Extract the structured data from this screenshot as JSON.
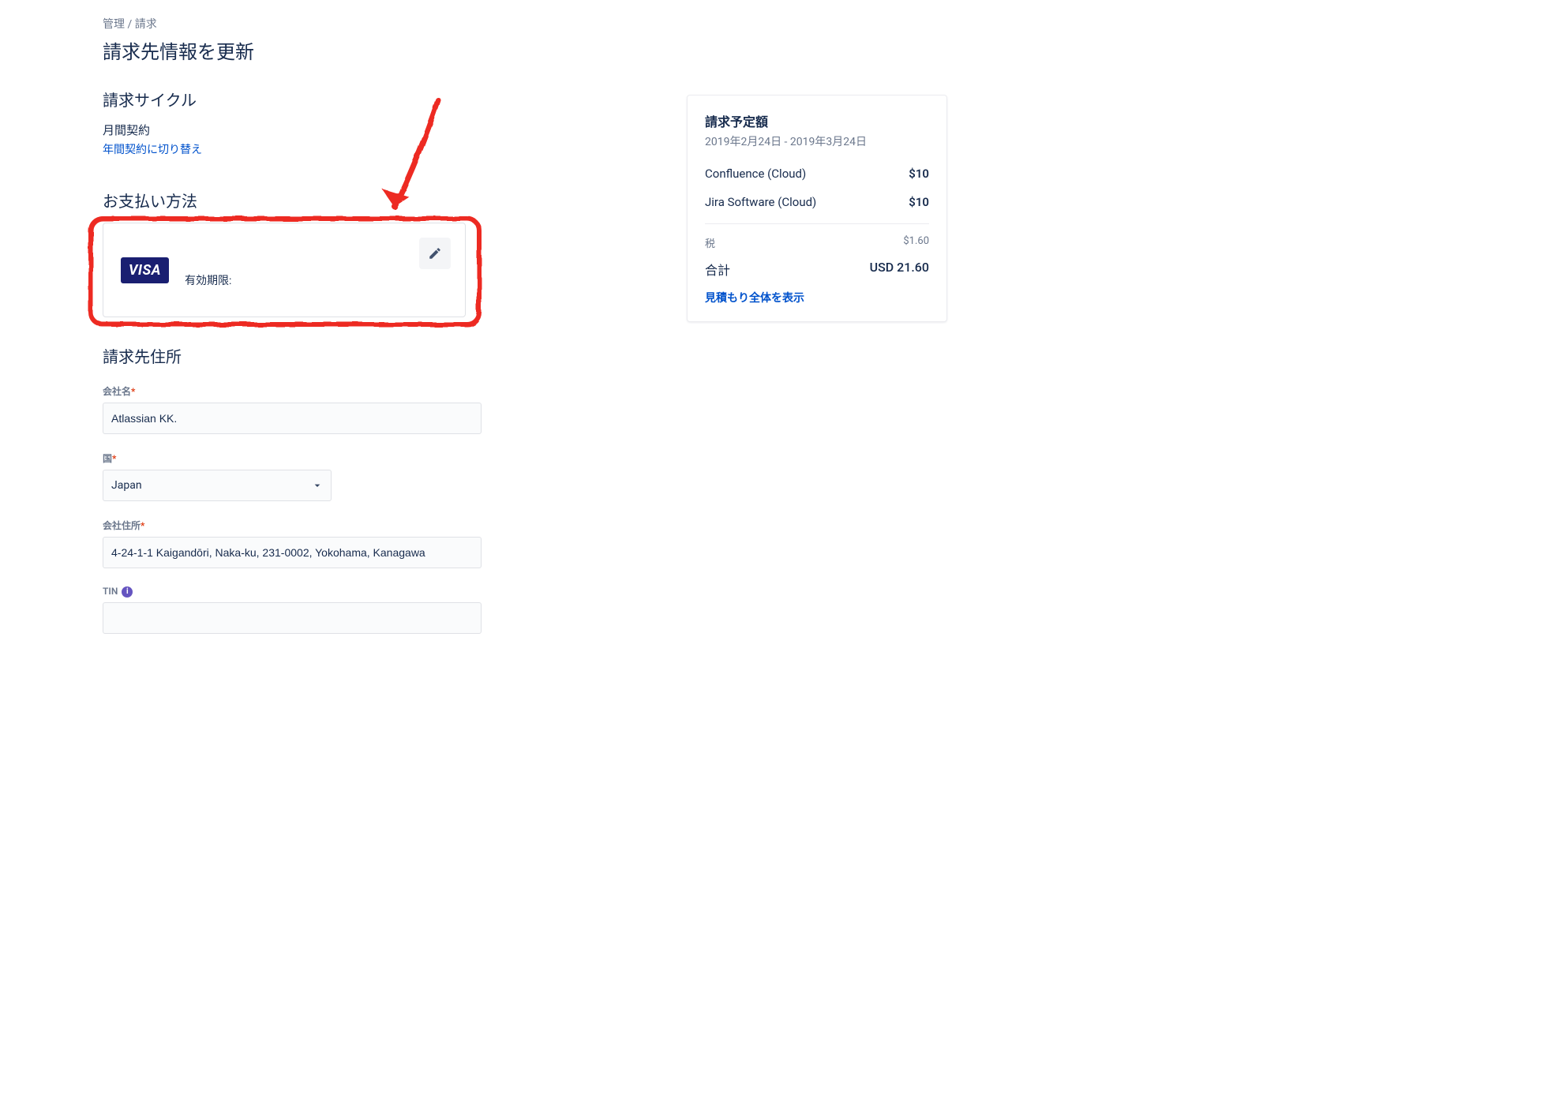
{
  "breadcrumb": {
    "admin": "管理",
    "sep": " / ",
    "billing": "請求"
  },
  "page_title": "請求先情報を更新",
  "cycle": {
    "heading": "請求サイクル",
    "current": "月間契約",
    "switch_link": "年間契約に切り替え"
  },
  "payment": {
    "heading": "お支払い方法",
    "brand": "VISA",
    "expiry_label": "有効期限:"
  },
  "address": {
    "heading": "請求先住所",
    "company_label": "会社名",
    "company_value": "Atlassian KK.",
    "country_label": "国",
    "country_value": "Japan",
    "address_label": "会社住所",
    "address_value": "4-24-1-1 Kaigandōri, Naka-ku, 231-0002, Yokohama, Kanagawa",
    "tin_label": "TIN",
    "tin_value": ""
  },
  "estimate": {
    "heading": "請求予定額",
    "range": "2019年2月24日 - 2019年3月24日",
    "items": [
      {
        "name": "Confluence (Cloud)",
        "price": "$10"
      },
      {
        "name": "Jira Software (Cloud)",
        "price": "$10"
      }
    ],
    "tax_label": "税",
    "tax_value": "$1.60",
    "total_label": "合計",
    "total_value": "USD 21.60",
    "view_link": "見積もり全体を表示"
  }
}
